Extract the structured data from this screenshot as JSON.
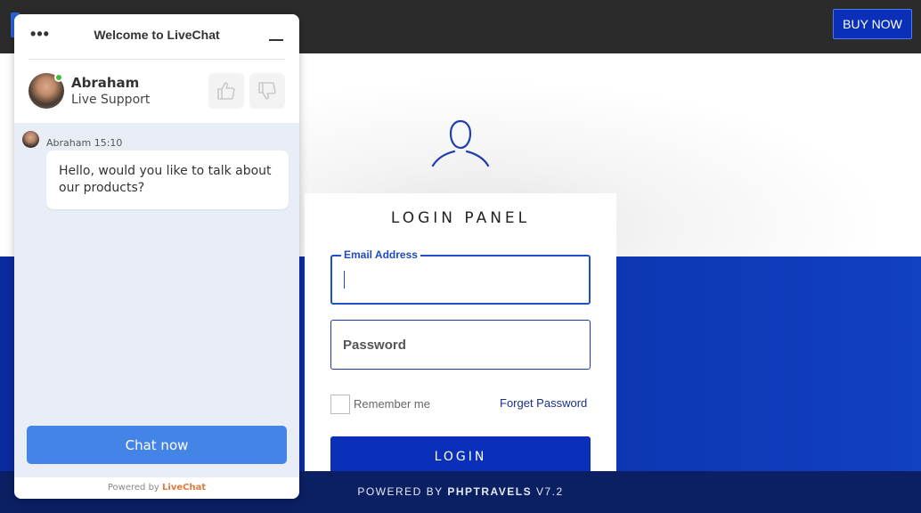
{
  "topbar": {
    "buy_now_label": "BUY NOW"
  },
  "login": {
    "title": "LOGIN PANEL",
    "email_label": "Email Address",
    "email_value": "",
    "password_placeholder": "Password",
    "remember_label": "Remember me",
    "remember_checked": false,
    "forget_label": "Forget Password",
    "login_button_label": "LOGIN"
  },
  "footer": {
    "prefix": "POWERED BY",
    "brand": "PHPTRAVELS",
    "version": "V7.2"
  },
  "livechat": {
    "title": "Welcome to LiveChat",
    "menu_glyph": "•••",
    "agent": {
      "name": "Abraham",
      "role": "Live Support",
      "status": "online"
    },
    "message": {
      "author": "Abraham",
      "time": "15:10",
      "meta": "Abraham 15:10",
      "text": "Hello, would you like to talk about our products?"
    },
    "chat_now_label": "Chat now",
    "powered_by": "Powered by",
    "powered_brand": "LiveChat"
  },
  "colors": {
    "accent_blue": "#0a2fb8",
    "topbar": "#2b2b2b",
    "footer": "#0b1f63",
    "chat_button": "#4384e6",
    "online": "#3cc13b"
  },
  "icons": [
    "user-outline-icon",
    "thumbs-up-icon",
    "thumbs-down-icon",
    "minimize-icon",
    "more-options-icon"
  ]
}
